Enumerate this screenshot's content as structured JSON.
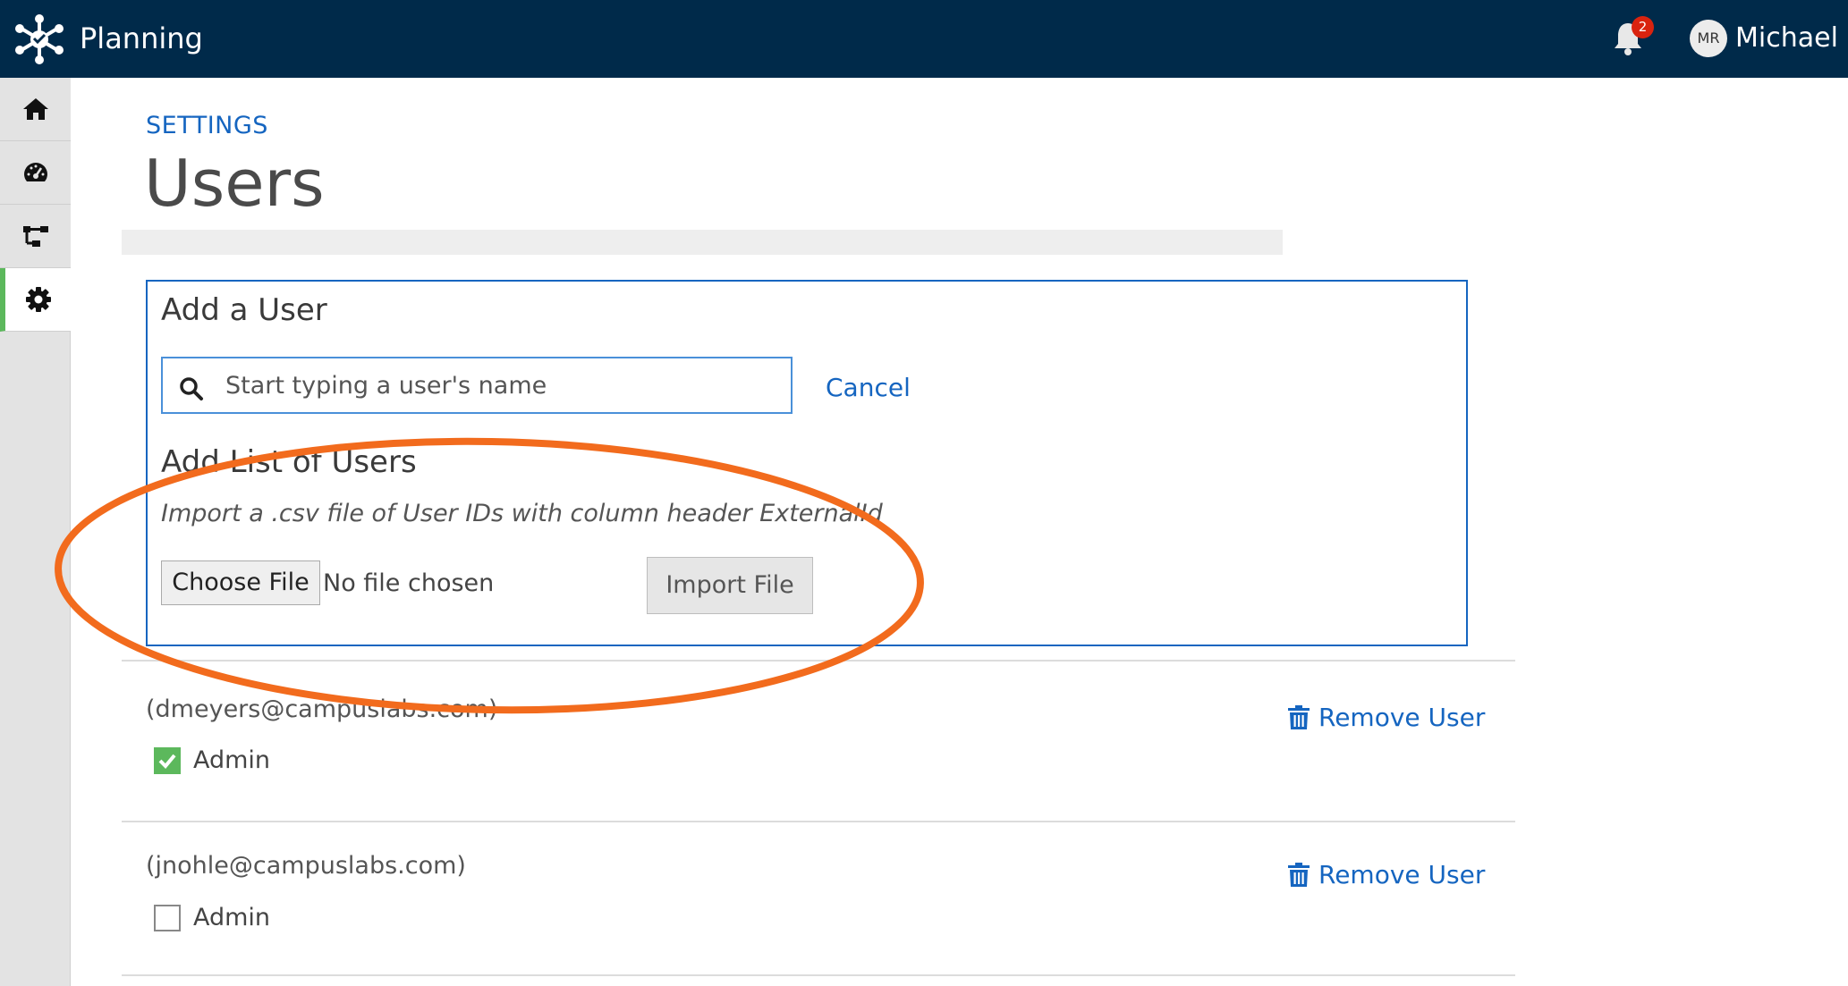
{
  "header": {
    "app_title": "Planning",
    "notification_count": "2",
    "avatar_initials": "MR",
    "user_name": "Michael"
  },
  "sidebar": {
    "items": [
      {
        "icon": "home-icon",
        "active": false
      },
      {
        "icon": "dashboard-icon",
        "active": false
      },
      {
        "icon": "hierarchy-icon",
        "active": false
      },
      {
        "icon": "gear-icon",
        "active": true
      }
    ]
  },
  "page": {
    "breadcrumb": "SETTINGS",
    "title": "Users"
  },
  "add_user": {
    "heading": "Add a User",
    "search_placeholder": "Start typing a user's name",
    "search_value": "",
    "cancel_label": "Cancel",
    "list_heading": "Add List of Users",
    "helper_text": "Import a .csv file of User IDs with column header ExternalId",
    "choose_file_label": "Choose File",
    "no_file_text": "No file chosen",
    "import_label": "Import File"
  },
  "users": [
    {
      "email": "(dmeyers@campuslabs.com)",
      "admin_label": "Admin",
      "is_admin": true,
      "remove_label": "Remove User"
    },
    {
      "email": "(jnohle@campuslabs.com)",
      "admin_label": "Admin",
      "is_admin": false,
      "remove_label": "Remove User"
    }
  ],
  "colors": {
    "topbar": "#002a4a",
    "link": "#1565c0",
    "active_accent": "#5cb85c",
    "annotation": "#f26b1d"
  }
}
